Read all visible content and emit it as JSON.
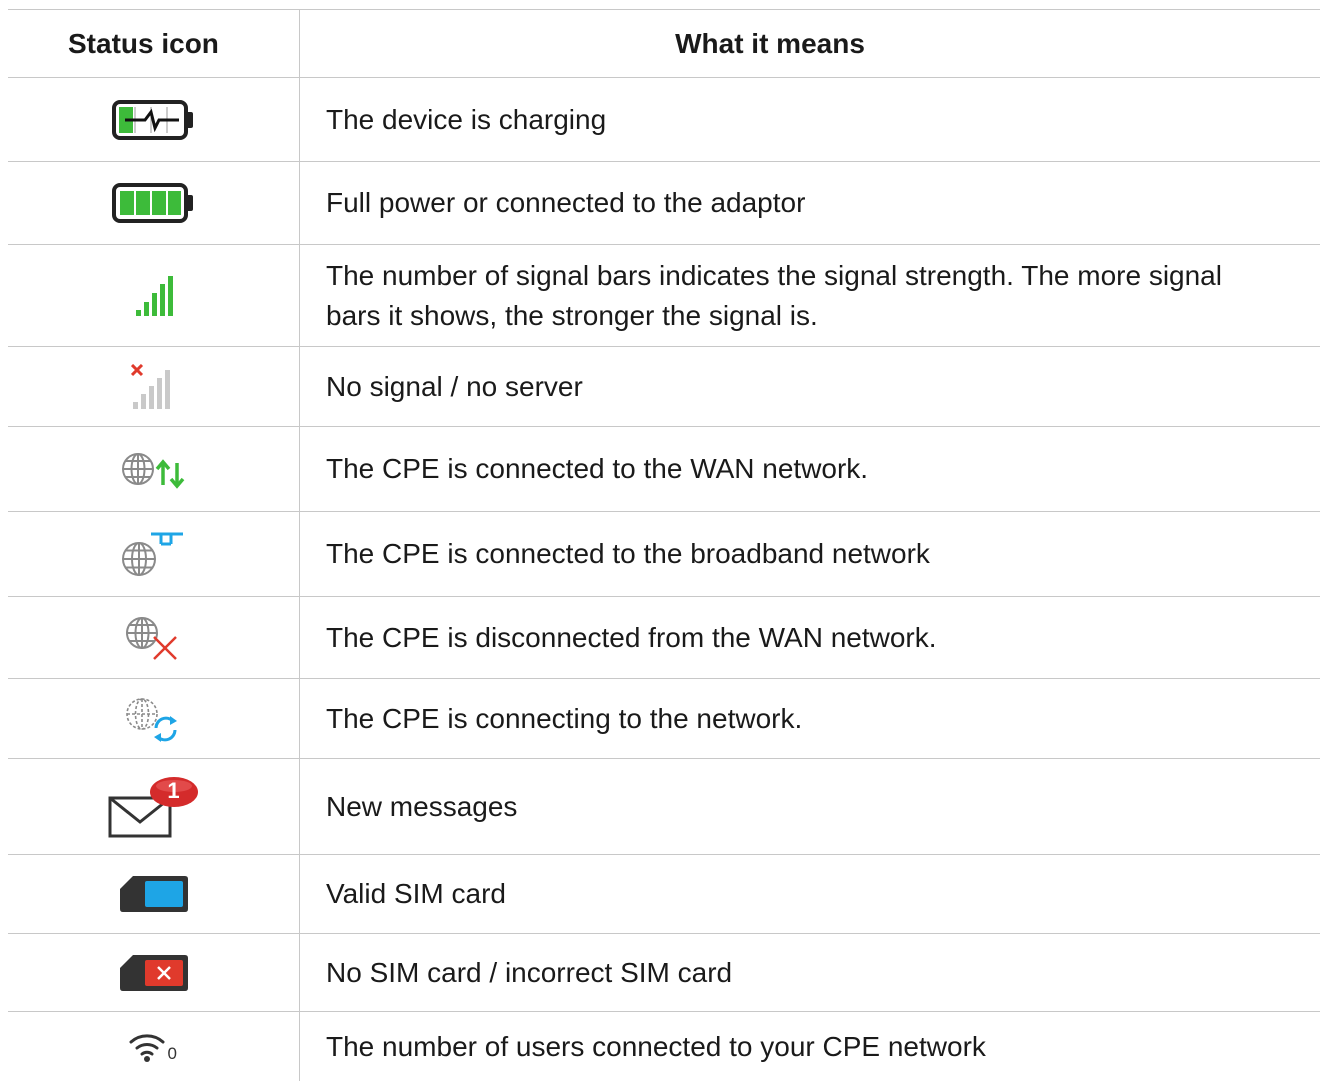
{
  "table": {
    "headers": {
      "icon": "Status icon",
      "meaning": "What it means"
    },
    "rows": [
      {
        "icon": "battery-charging-icon",
        "meaning": "The device is charging"
      },
      {
        "icon": "battery-full-icon",
        "meaning": "Full power or connected to the adaptor"
      },
      {
        "icon": "signal-bars-icon",
        "meaning": "The number of signal bars indicates the signal strength. The more signal bars it shows, the stronger the signal is."
      },
      {
        "icon": "no-signal-icon",
        "meaning": "No signal / no server"
      },
      {
        "icon": "wan-connected-icon",
        "meaning": "The CPE is connected to the WAN network."
      },
      {
        "icon": "broadband-connected-icon",
        "meaning": "The CPE is connected to the broadband network"
      },
      {
        "icon": "wan-disconnected-icon",
        "meaning": "The CPE is disconnected from the WAN network."
      },
      {
        "icon": "network-connecting-icon",
        "meaning": "The CPE is connecting to the network."
      },
      {
        "icon": "new-messages-icon",
        "meaning": "New messages",
        "badge": "1"
      },
      {
        "icon": "sim-valid-icon",
        "meaning": "Valid SIM card"
      },
      {
        "icon": "sim-invalid-icon",
        "meaning": "No SIM card / incorrect SIM card"
      },
      {
        "icon": "wifi-users-icon",
        "meaning": "The number of users connected to your CPE network",
        "user_count": "0"
      }
    ]
  },
  "colors": {
    "green": "#3dbb3a",
    "red": "#e03a2c",
    "blue": "#1ea5e6",
    "grey": "#8a8a8a",
    "light_grey": "#c9c9c9",
    "dark": "#333333",
    "badge_red": "#d42b2b"
  }
}
